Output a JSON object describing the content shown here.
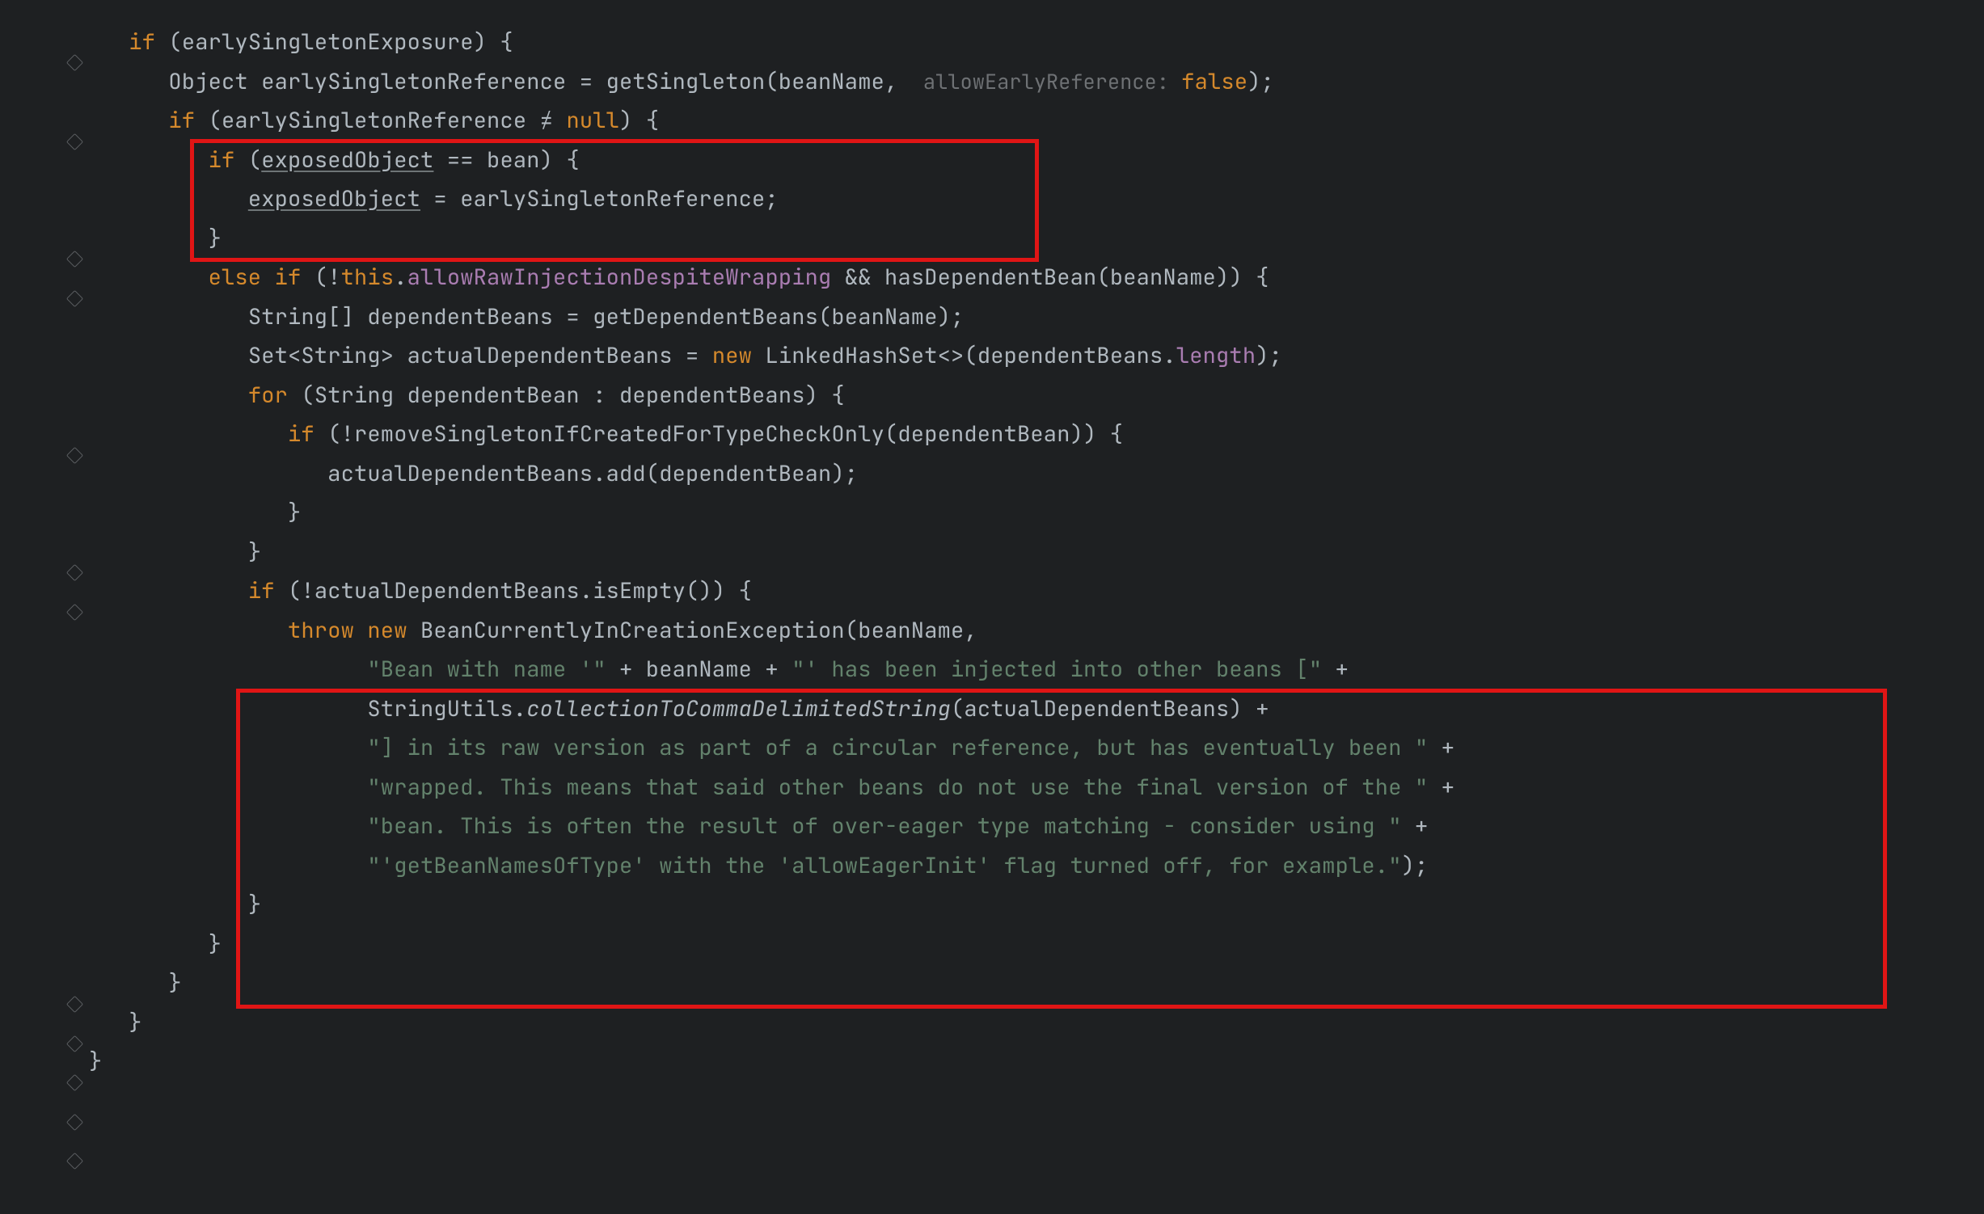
{
  "code": {
    "l1": {
      "kw_if": "if",
      "cond": "(earlySingletonExposure)",
      "brace": " {"
    },
    "l2": {
      "a": "Object earlySingletonReference = getSingleton(beanName, ",
      "hint": " allowEarlyReference: ",
      "lit": "false",
      "end": ");"
    },
    "l3": {
      "kw_if": "if",
      "a": " (earlySingletonReference ",
      "neq": "≠ ",
      "null": "null",
      "end": ") {"
    },
    "l4": {
      "kw_if": "if",
      "a": " (",
      "u1": "exposedObject",
      "eq": " == ",
      "b": "bean) {"
    },
    "l5": {
      "u1": "exposedObject",
      "a": " = earlySingletonReference;"
    },
    "l6": {
      "brace": "}"
    },
    "l7": {
      "kw_else": "else if",
      "a": " (!",
      "this": "this",
      "dot": ".",
      "field": "allowRawInjectionDespiteWrapping",
      "b": " && hasDependentBean(beanName)) {"
    },
    "l8": {
      "a": "String[] dependentBeans = getDependentBeans(beanName);"
    },
    "l9": {
      "a": "Set<String> actualDependentBeans = ",
      "new": "new",
      "b": " LinkedHashSet<>(dependentBeans.",
      "len": "length",
      "c": ");"
    },
    "l10": {
      "kw_for": "for",
      "a": " (String dependentBean : dependentBeans) {"
    },
    "l11": {
      "kw_if": "if",
      "a": " (!removeSingletonIfCreatedForTypeCheckOnly(dependentBean)) {"
    },
    "l12": {
      "a": "actualDependentBeans.add(dependentBean);"
    },
    "l13": {
      "brace": "}"
    },
    "l14": {
      "brace": "}"
    },
    "l15": {
      "kw_if": "if",
      "a": " (!actualDependentBeans.isEmpty()) {"
    },
    "l16": {
      "throw": "throw ",
      "new": "new",
      "a": " BeanCurrentlyInCreationException(beanName,"
    },
    "l17": {
      "s1": "\"Bean with name '\"",
      "a": " + beanName + ",
      "s2": "\"' has been injected into other beans [\"",
      "plus": " +"
    },
    "l18": {
      "a": "StringUtils.",
      "m": "collectionToCommaDelimitedString",
      "b": "(actualDependentBeans) +"
    },
    "l19": {
      "s": "\"] in its raw version as part of a circular reference, but has eventually been \"",
      "plus": " +"
    },
    "l20": {
      "s": "\"wrapped. This means that said other beans do not use the final version of the \"",
      "plus": " +"
    },
    "l21": {
      "s": "\"bean. This is often the result of over-eager type matching - consider using \"",
      "plus": " +"
    },
    "l22": {
      "s": "\"'getBeanNamesOfType' with the 'allowEagerInit' flag turned off, for example.\"",
      "end": ");"
    },
    "l23": {
      "brace": "}"
    },
    "l24": {
      "brace": "}"
    },
    "l25": {
      "brace": "}"
    },
    "l26": {
      "brace": "}"
    },
    "l27": {
      "brace": "}"
    }
  }
}
